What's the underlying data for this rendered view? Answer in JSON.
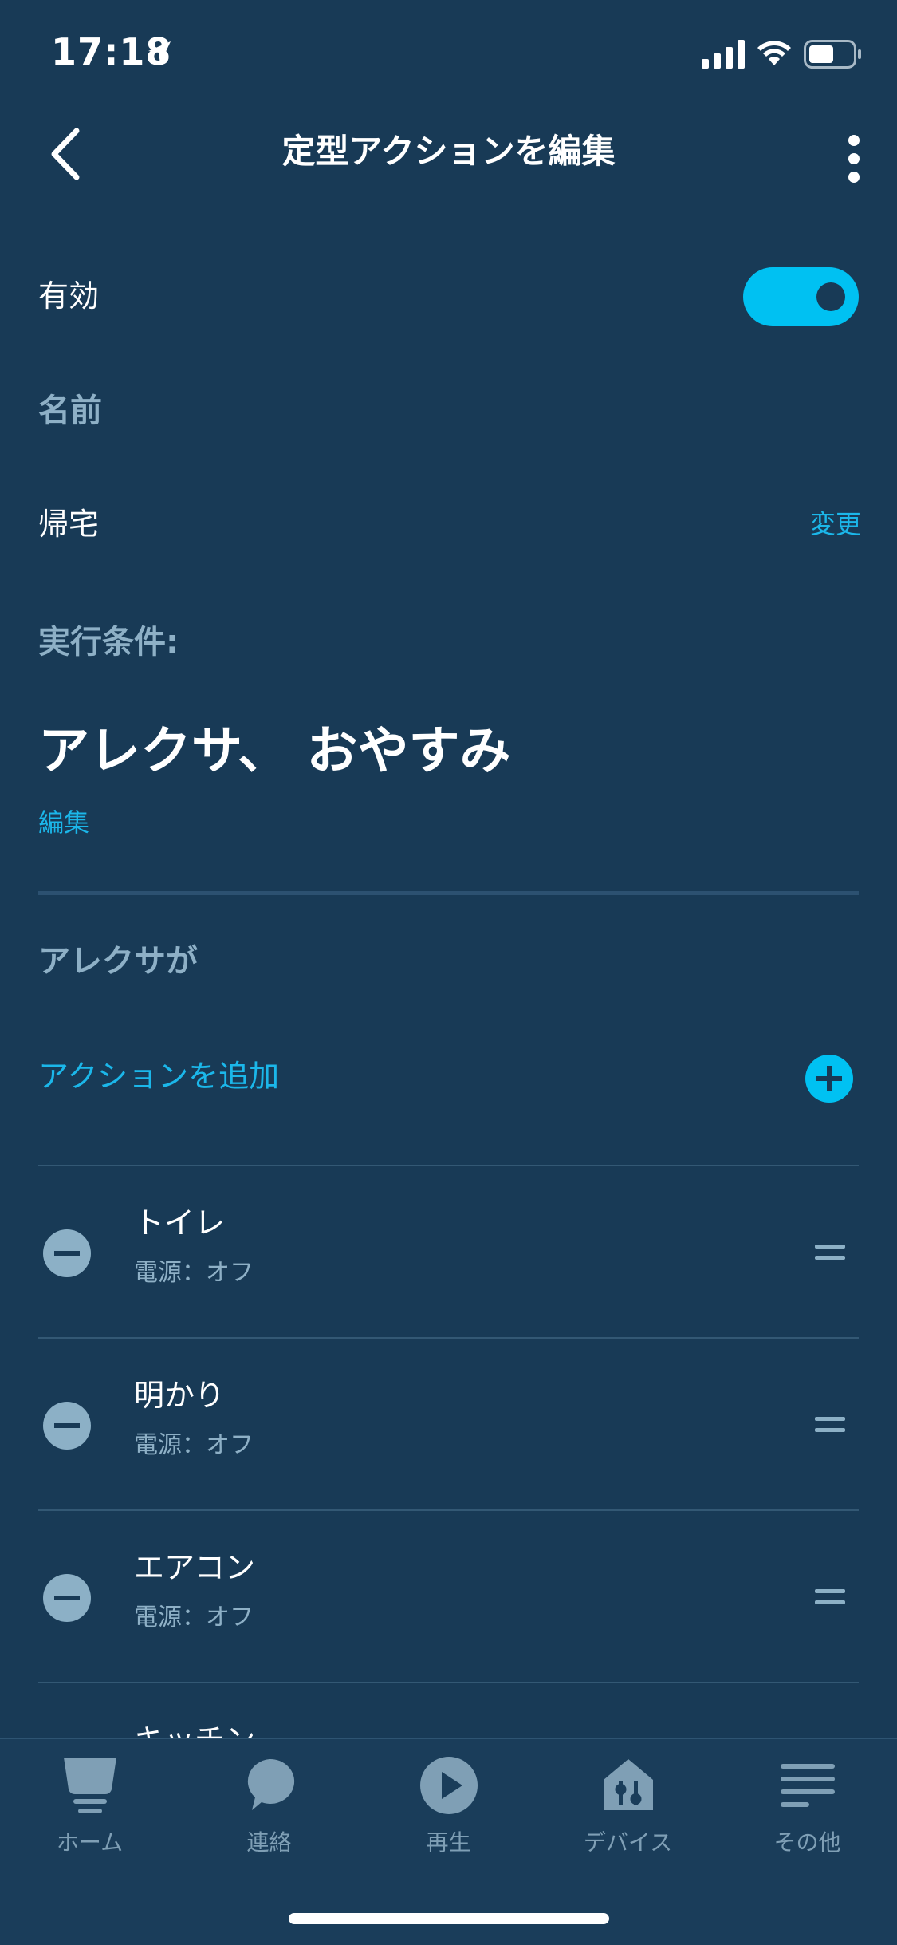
{
  "status_bar": {
    "time": "17:18"
  },
  "header": {
    "title": "定型アクションを編集"
  },
  "enabled": {
    "label": "有効",
    "on": true
  },
  "name_section": {
    "heading": "名前",
    "value": "帰宅",
    "change_link": "変更"
  },
  "condition": {
    "heading": "実行条件:",
    "phrase": "アレクサ、 おやすみ",
    "edit_link": "編集"
  },
  "actions": {
    "heading": "アレクサが",
    "add_label": "アクションを追加",
    "items": [
      {
        "name": "トイレ",
        "detail": "電源：オフ"
      },
      {
        "name": "明かり",
        "detail": "電源：オフ"
      },
      {
        "name": "エアコン",
        "detail": "電源：オフ"
      },
      {
        "name": "キッチン"
      }
    ]
  },
  "tabbar": {
    "tabs": [
      {
        "label": "ホーム",
        "icon": "home-icon"
      },
      {
        "label": "連絡",
        "icon": "chat-icon"
      },
      {
        "label": "再生",
        "icon": "play-icon"
      },
      {
        "label": "デバイス",
        "icon": "devices-icon"
      },
      {
        "label": "その他",
        "icon": "menu-icon"
      }
    ]
  },
  "colors": {
    "background": "#183a56",
    "accent": "#00c1f2",
    "muted": "#8eb0c6"
  }
}
